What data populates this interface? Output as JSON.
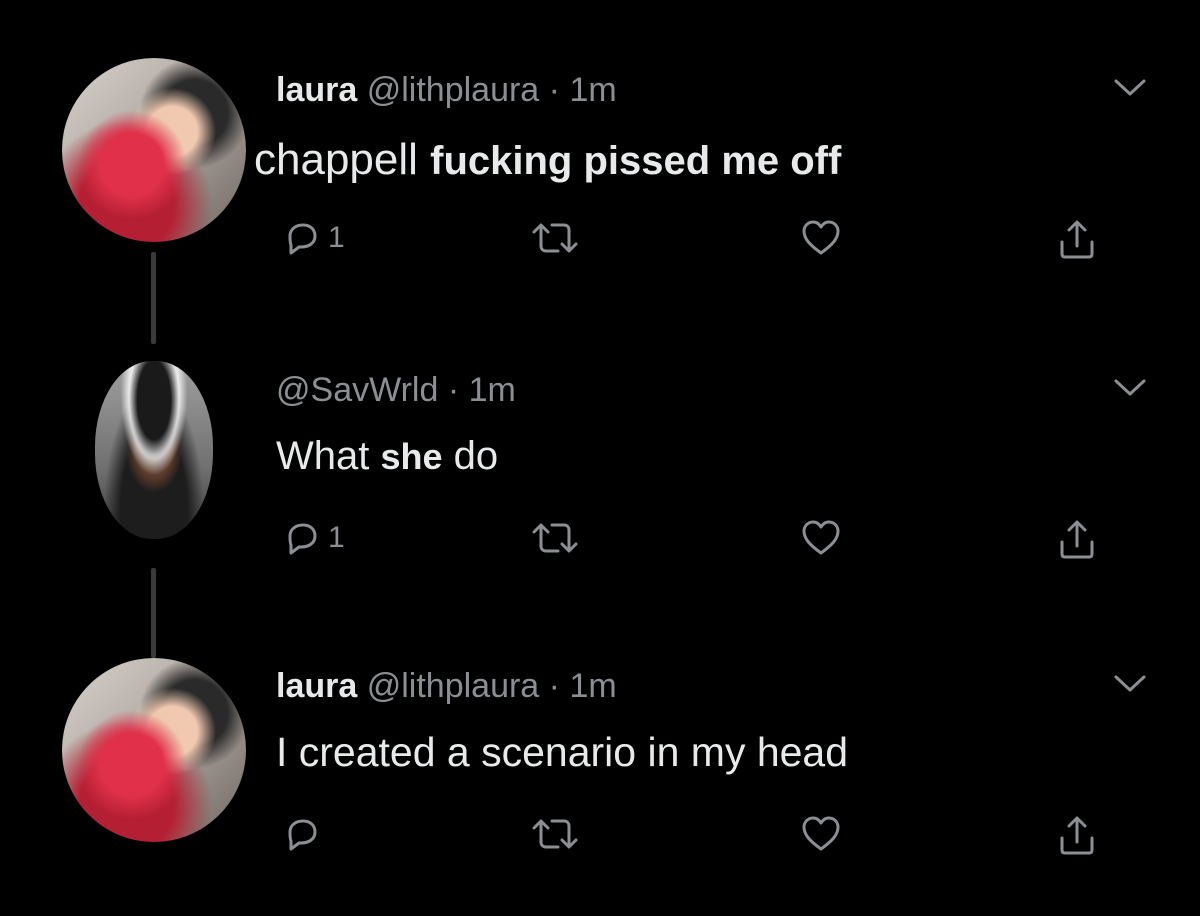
{
  "tweets": [
    {
      "name": "laura",
      "handle": "@lithplaura",
      "separator": "·",
      "time": "1m",
      "body_parts": [
        "chappell",
        "fucking pissed me off"
      ],
      "reply_count": "1"
    },
    {
      "name": "",
      "handle": "@SavWrld",
      "separator": "·",
      "time": "1m",
      "body_parts": [
        "What",
        "she",
        "do"
      ],
      "reply_count": "1"
    },
    {
      "name": "laura",
      "handle": "@lithplaura",
      "separator": "·",
      "time": "1m",
      "body_parts": [
        "I created a scenario in my head"
      ],
      "reply_count": ""
    }
  ],
  "icons": {
    "reply": "reply-icon",
    "retweet": "retweet-icon",
    "like": "heart-icon",
    "share": "share-icon",
    "more": "chevron-down-icon"
  },
  "colors": {
    "background": "#000000",
    "text": "#e7e9ea",
    "muted": "#8b8f94",
    "thread_line": "#3a3a3a"
  }
}
